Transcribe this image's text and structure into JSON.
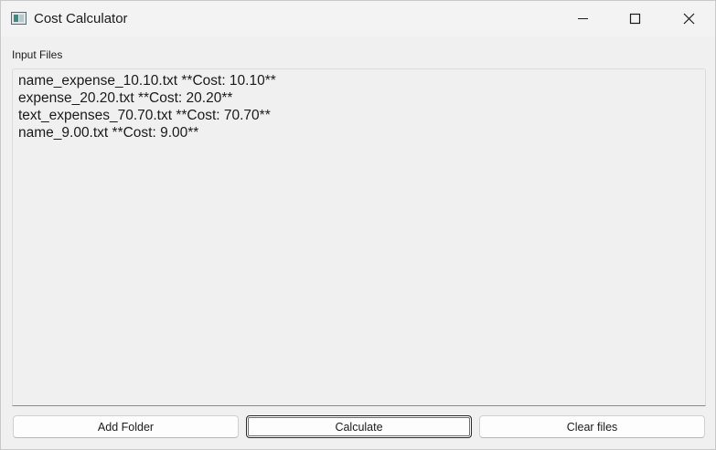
{
  "window": {
    "title": "Cost Calculator",
    "app_icon": "window-app-icon",
    "controls": {
      "minimize_icon": "minimize-icon",
      "maximize_icon": "maximize-icon",
      "close_icon": "close-icon"
    }
  },
  "input_files": {
    "label": "Input Files",
    "items": [
      "name_expense_10.10.txt **Cost: 10.10**",
      "expense_20.20.txt **Cost: 20.20**",
      "text_expenses_70.70.txt **Cost: 70.70**",
      "name_9.00.txt **Cost: 9.00**"
    ]
  },
  "buttons": {
    "add_folder": "Add Folder",
    "calculate": "Calculate",
    "clear_files": "Clear files"
  },
  "colors": {
    "window_background": "#f0f0f0",
    "titlebar_background": "#f3f3f3",
    "text": "#1a1a1a",
    "focused_button_border": "#2a2a2a"
  }
}
